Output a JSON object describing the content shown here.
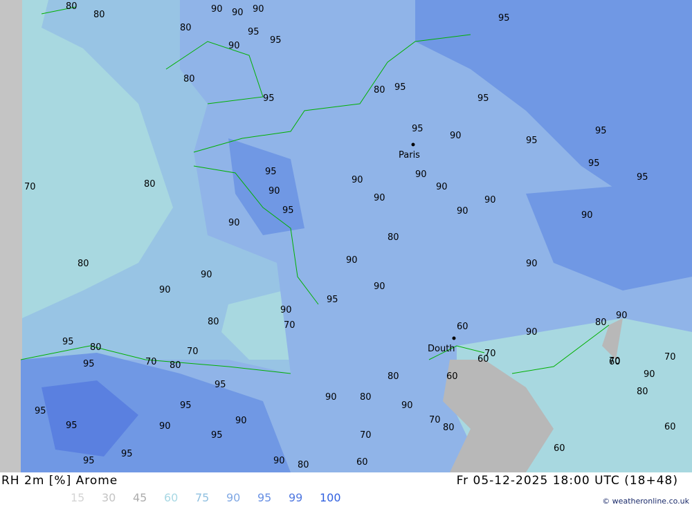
{
  "title": "RH 2m [%] Arome",
  "datetime": "Fr 05-12-2025 18:00 UTC (18+48)",
  "credit": "© weatheronline.co.uk",
  "legend": [
    {
      "label": "15",
      "color": "#d4d4d4"
    },
    {
      "label": "30",
      "color": "#c4c4c4"
    },
    {
      "label": "45",
      "color": "#acacac"
    },
    {
      "label": "60",
      "color": "#a8d8e4"
    },
    {
      "label": "75",
      "color": "#90c0e0"
    },
    {
      "label": "90",
      "color": "#80a8e4"
    },
    {
      "label": "95",
      "color": "#6890e4"
    },
    {
      "label": "99",
      "color": "#5078e0"
    },
    {
      "label": "100",
      "color": "#3060e0"
    }
  ],
  "cities": [
    "Paris",
    "Douth"
  ],
  "contour_labels": [
    "80",
    "80",
    "90",
    "90",
    "90",
    "95",
    "80",
    "80",
    "90",
    "95",
    "70",
    "80",
    "80",
    "90",
    "90",
    "90",
    "95",
    "90",
    "95",
    "90",
    "95",
    "90",
    "95",
    "95",
    "95",
    "90",
    "95",
    "80",
    "90",
    "90",
    "90",
    "90",
    "90",
    "95",
    "95",
    "90",
    "80",
    "90",
    "70",
    "80",
    "90",
    "70",
    "60",
    "60",
    "80",
    "90",
    "95",
    "95",
    "90",
    "95",
    "95",
    "80",
    "70",
    "80",
    "70",
    "90",
    "60",
    "70",
    "60",
    "70",
    "80",
    "60",
    "90",
    "95",
    "70",
    "60",
    "90",
    "95",
    "80",
    "95",
    "95",
    "90",
    "95",
    "95",
    "90",
    "95",
    "95",
    "60",
    "80",
    "90",
    "80",
    "70",
    "80",
    "90"
  ],
  "colors": {
    "no_data": "#c4c4c4",
    "sea_light": "#a8d8e0",
    "mid": "#98c4e4",
    "land90": "#90b4e8",
    "high95": "#7098e4",
    "high99": "#5a80e0",
    "coast": "#00b000",
    "contour": "#808080"
  }
}
